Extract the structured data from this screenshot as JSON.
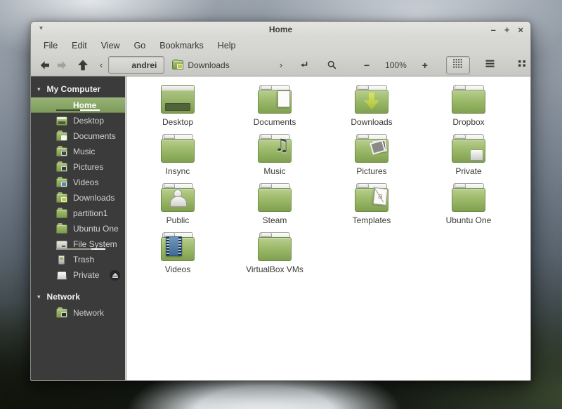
{
  "colors": {
    "mint_selection_green": "#8fae6a",
    "folder_green": "#8fae58",
    "sidebar_bg": "#3b3b3b",
    "toolbar_gray": "#cccccc8",
    "main_bg": "#ffffff"
  },
  "window": {
    "title": "Home",
    "menu_glyph": "▾",
    "controls": [
      {
        "name": "minimize",
        "glyph": "–"
      },
      {
        "name": "maximize",
        "glyph": "+"
      },
      {
        "name": "close",
        "glyph": "×"
      }
    ]
  },
  "menubar": {
    "items": [
      "File",
      "Edit",
      "View",
      "Go",
      "Bookmarks",
      "Help"
    ]
  },
  "toolbar": {
    "breadcrumb_overflow_left": "‹",
    "breadcrumb_overflow_right": "›",
    "crumbs": [
      {
        "label": "andrei",
        "icon": "home",
        "active": true
      },
      {
        "label": "Downloads",
        "icon": "folder-downloads",
        "active": false
      }
    ],
    "zoom_out": "−",
    "zoom_level": "100%",
    "zoom_in": "+",
    "views": [
      {
        "name": "icon-view",
        "active": true
      },
      {
        "name": "list-view",
        "active": false
      },
      {
        "name": "compact-view",
        "active": false
      }
    ]
  },
  "sidebar": {
    "sections": [
      {
        "label": "My Computer",
        "items": [
          {
            "label": "Home",
            "icon": "home",
            "selected": true,
            "usage_bar": [
              {
                "width": 34,
                "color": "#3e4a39"
              },
              {
                "width": 28,
                "color": "#ffffff"
              }
            ]
          },
          {
            "label": "Desktop",
            "icon": "desktop"
          },
          {
            "label": "Documents",
            "icon": "folder-documents"
          },
          {
            "label": "Music",
            "icon": "folder-music"
          },
          {
            "label": "Pictures",
            "icon": "folder-pictures"
          },
          {
            "label": "Videos",
            "icon": "folder-videos"
          },
          {
            "label": "Downloads",
            "icon": "folder-downloads"
          },
          {
            "label": "partition1",
            "icon": "folder"
          },
          {
            "label": "Ubuntu One",
            "icon": "folder"
          },
          {
            "label": "File System",
            "icon": "drive",
            "usage_bar": [
              {
                "width": 50,
                "color": "#9aa392"
              },
              {
                "width": 20,
                "color": "#ffffff"
              }
            ]
          },
          {
            "label": "Trash",
            "icon": "trash"
          },
          {
            "label": "Private",
            "icon": "box",
            "eject": true
          }
        ]
      },
      {
        "label": "Network",
        "items": [
          {
            "label": "Network",
            "icon": "network"
          }
        ]
      }
    ]
  },
  "files": {
    "folders": [
      {
        "name": "Desktop",
        "emblem": "desktop"
      },
      {
        "name": "Documents",
        "emblem": "paper"
      },
      {
        "name": "Downloads",
        "emblem": "down-arrow"
      },
      {
        "name": "Dropbox",
        "emblem": "none"
      },
      {
        "name": "Insync",
        "emblem": "none"
      },
      {
        "name": "Music",
        "emblem": "music-note"
      },
      {
        "name": "Pictures",
        "emblem": "photo"
      },
      {
        "name": "Private",
        "emblem": "box"
      },
      {
        "name": "Public",
        "emblem": "person"
      },
      {
        "name": "Steam",
        "emblem": "none"
      },
      {
        "name": "Templates",
        "emblem": "template"
      },
      {
        "name": "Ubuntu One",
        "emblem": "none"
      },
      {
        "name": "Videos",
        "emblem": "film"
      },
      {
        "name": "VirtualBox VMs",
        "emblem": "none"
      }
    ]
  },
  "icon_glyphs": {
    "music_note": "♫",
    "template_letter": "a"
  }
}
